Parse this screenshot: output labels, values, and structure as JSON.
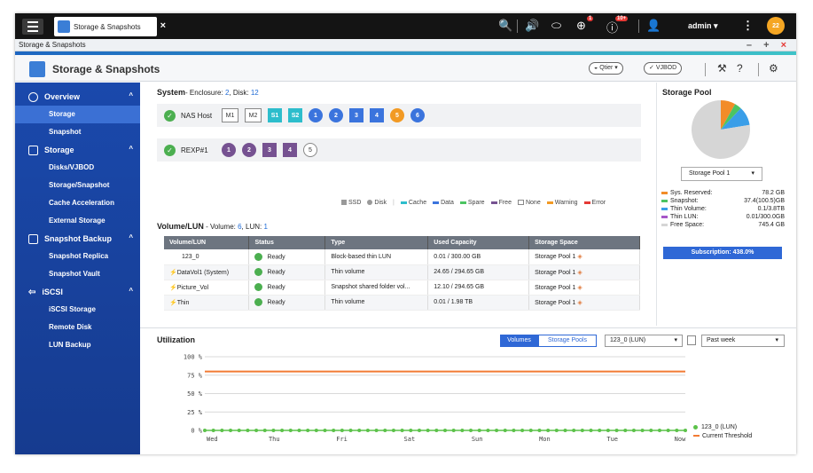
{
  "topbar": {
    "tab_label": "Storage & Snapshots",
    "notif_count": "1",
    "alert_count": "10+",
    "user": "admin",
    "avatar_text": "22"
  },
  "window": {
    "title": "Storage & Snapshots",
    "controls": "– + ×"
  },
  "app": {
    "title": "Storage & Snapshots",
    "qtier": "Qtier",
    "vjbod": "VJBOD"
  },
  "sidebar": {
    "overview": "Overview",
    "storage_sub": "Storage",
    "snapshot_sub": "Snapshot",
    "storage": "Storage",
    "disks": "Disks/VJBOD",
    "storage_snapshot": "Storage/Snapshot",
    "cache": "Cache Acceleration",
    "external": "External Storage",
    "snapshot_backup": "Snapshot Backup",
    "replica": "Snapshot Replica",
    "vault": "Snapshot Vault",
    "iscsi": "iSCSI",
    "iscsi_storage": "iSCSI Storage",
    "remote_disk": "Remote Disk",
    "lun_backup": "LUN Backup"
  },
  "system": {
    "title": "System",
    "enc_label": "- Enclosure: ",
    "enc_count": "2",
    "disk_label": ", Disk: ",
    "disk_count": "12",
    "nas_host": "NAS Host",
    "rexp": "REXP#1",
    "nas_slots": [
      "M1",
      "M2",
      "S1",
      "S2",
      "1",
      "2",
      "3",
      "4",
      "5",
      "6"
    ],
    "rexp_slots": [
      "1",
      "2",
      "3",
      "4",
      "5"
    ]
  },
  "legend": {
    "ssd": "SSD",
    "disk": "Disk",
    "cache": "Cache",
    "data": "Data",
    "spare": "Spare",
    "free": "Free",
    "none": "None",
    "warning": "Warning",
    "error": "Error"
  },
  "volume": {
    "title": "Volume/LUN",
    "sub": " - Volume: ",
    "vol_count": "6",
    "lun_label": ", LUN: ",
    "lun_count": "1",
    "headers": [
      "Volume/LUN",
      "Status",
      "Type",
      "Used Capacity",
      "Storage Space"
    ],
    "rows": [
      [
        "123_0",
        "Ready",
        "Block-based thin LUN",
        "0.01 / 300.00 GB",
        "Storage Pool 1"
      ],
      [
        "DataVol1 (System)",
        "Ready",
        "Thin volume",
        "24.65 / 294.65 GB",
        "Storage Pool 1"
      ],
      [
        "Picture_Vol",
        "Ready",
        "Snapshot shared folder vol...",
        "12.10 / 294.65 GB",
        "Storage Pool 1"
      ],
      [
        "Thin",
        "Ready",
        "Thin volume",
        "0.01 / 1.98 TB",
        "Storage Pool 1"
      ]
    ]
  },
  "pool": {
    "title": "Storage Pool",
    "selected": "Storage Pool 1",
    "stats": [
      {
        "label": "Sys. Reserved:",
        "value": "78.2 GB",
        "color": "#f28c28"
      },
      {
        "label": "Snapshot:",
        "value": "37.4(100.5)GB",
        "color": "#4cc462"
      },
      {
        "label": "Thin Volume:",
        "value": "0.1/3.8TB",
        "color": "#3a9ee8"
      },
      {
        "label": "Thin LUN:",
        "value": "0.01/300.0GB",
        "color": "#a657c8"
      },
      {
        "label": "Free Space:",
        "value": "745.4 GB",
        "color": "#d6d6d6"
      }
    ],
    "subscription": "Subscription: 438.0%"
  },
  "utilization": {
    "title": "Utilization",
    "btn_volumes": "Volumes",
    "btn_pools": "Storage Pools",
    "lun_select": "123_0 (LUN)",
    "range_select": "Past week",
    "series_name": "123_0 (LUN)",
    "threshold_name": "Current Threshold"
  },
  "chart_data": {
    "type": "line",
    "y_ticks": [
      "100 %",
      "75 %",
      "50 %",
      "25 %",
      "0 %"
    ],
    "x_ticks": [
      "Wed",
      "Thu",
      "Fri",
      "Sat",
      "Sun",
      "Mon",
      "Tue",
      "Now"
    ],
    "ylim": [
      0,
      100
    ],
    "series": [
      {
        "name": "123_0 (LUN)",
        "values": [
          0,
          0,
          0,
          0,
          0,
          0,
          0,
          0,
          0,
          0,
          0,
          0,
          0,
          0,
          0,
          0,
          0,
          0,
          0,
          0,
          0,
          0,
          0,
          0,
          0,
          0,
          0,
          0,
          0,
          0,
          0,
          0,
          0,
          0,
          0,
          0,
          0,
          0,
          0,
          0,
          0,
          0,
          0,
          0,
          0,
          0,
          0,
          0,
          0,
          0,
          0,
          0,
          0,
          0,
          0,
          0,
          0
        ],
        "color": "#5cc24a"
      },
      {
        "name": "Current Threshold",
        "values": [
          80,
          80
        ],
        "color": "#f27b34"
      }
    ],
    "pie": [
      {
        "label": "Sys. Reserved",
        "value": 78.2,
        "color": "#f28c28"
      },
      {
        "label": "Snapshot",
        "value": 37.4,
        "color": "#4cc462"
      },
      {
        "label": "Thin Volume",
        "value": 100,
        "color": "#3a9ee8"
      },
      {
        "label": "Free Space",
        "value": 745.4,
        "color": "#d6d6d6"
      }
    ]
  }
}
